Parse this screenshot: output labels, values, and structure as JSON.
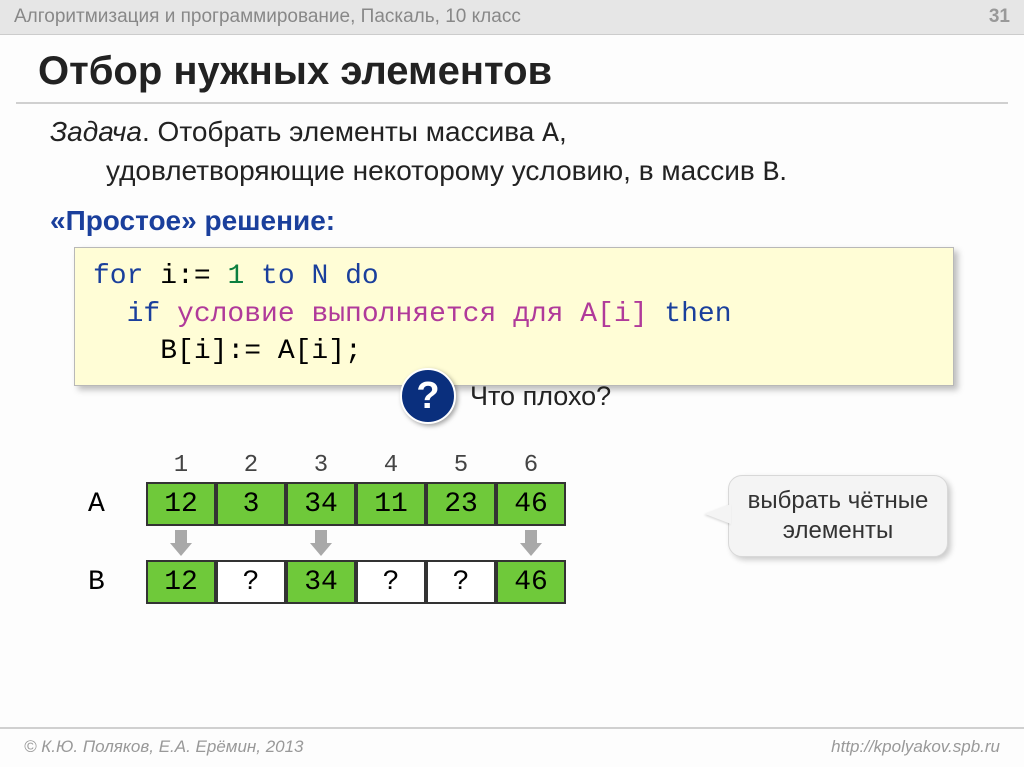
{
  "header": {
    "breadcrumb": "Алгоритмизация и программирование, Паскаль, 10 класс",
    "page_number": "31"
  },
  "title": "Отбор нужных элементов",
  "task": {
    "prefix": "Задача",
    "line1": ". Отобрать элементы массива ",
    "arrA": "A",
    "comma": ",",
    "line2": "удовлетворяющие некоторому условию, в массив ",
    "arrB": "B",
    "dot": "."
  },
  "simple_heading": "«Простое» решение:",
  "code": {
    "for": "for",
    "i_assign": " i:= ",
    "one": "1",
    "to": " to",
    "N_do": " N do",
    "if": "  if",
    "cond": " условие выполняется для A[i]",
    "then": " then",
    "assign": "    B[i]:= A[i];"
  },
  "question": {
    "mark": "?",
    "text": "Что плохо?"
  },
  "arrays": {
    "indices": [
      "1",
      "2",
      "3",
      "4",
      "5",
      "6"
    ],
    "A_label": "A",
    "A": [
      "12",
      "3",
      "34",
      "11",
      "23",
      "46"
    ],
    "B_label": "B",
    "B": [
      "12",
      "?",
      "34",
      "?",
      "?",
      "46"
    ],
    "B_colors": [
      "green",
      "white",
      "green",
      "white",
      "white",
      "green"
    ],
    "arrow_present": [
      true,
      false,
      true,
      false,
      false,
      true
    ]
  },
  "callout": "выбрать чётные элементы",
  "footer": {
    "left": "© К.Ю. Поляков, Е.А. Ерёмин, 2013",
    "right": "http://kpolyakov.spb.ru"
  }
}
